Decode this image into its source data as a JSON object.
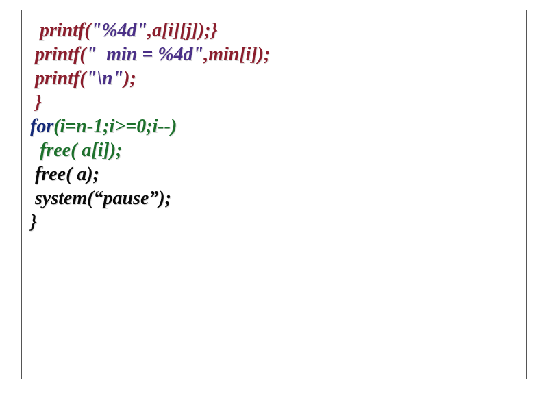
{
  "code": {
    "l1": {
      "a": "  printf(",
      "b": "\"%4d\"",
      "c": ",a[i][j]);}"
    },
    "l2": {
      "a": " printf(",
      "b": "\"  min = %4d\"",
      "c": ",min[i]);"
    },
    "l3": {
      "a": " printf(",
      "b": "\"\\n\"",
      "c": ");"
    },
    "l4": " }",
    "l5": "for",
    "l5b": "(i=n-1;i>=0;i--)",
    "l6": "  free( a[i]);",
    "l7": " free( a);",
    "l8": " system(“pause”);",
    "l9": "}"
  }
}
